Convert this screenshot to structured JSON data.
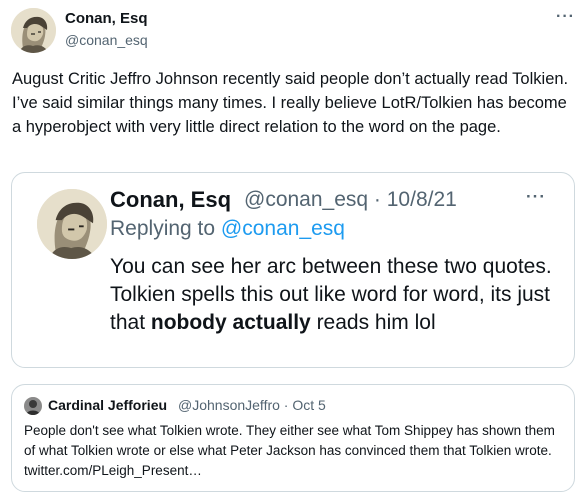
{
  "tweet": {
    "author_name": "Conan, Esq",
    "author_handle": "@conan_esq",
    "more_icon": "···",
    "text": "August Critic Jeffro Johnson recently said people don’t actually read Tolkien. I’ve said similar things many times. I really believe LotR/Tolkien has become a hyperobject with very little direct relation to the word on the page."
  },
  "quoted_tweet": {
    "author_name": "Conan, Esq",
    "author_handle": "@conan_esq",
    "date": "10/8/21",
    "more_icon": "···",
    "replying_to_prefix": "Replying to",
    "replying_to_handle": "@conan_esq",
    "text_before_bold": "You can see her arc between these two quotes. Tolkien spells this out like word for word, its just that ",
    "text_bold": "nobody actually",
    "text_after_bold": " reads him lol"
  },
  "nested_quote": {
    "author_name": "Cardinal Jefforieu",
    "author_handle": "@JohnsonJeffro",
    "date": "Oct 5",
    "text": "People don't see what Tolkien wrote. They either see what Tom Shippey has shown them of what Tolkien wrote or else what Peter Jackson has convinced them that Tolkien wrote. twitter.com/PLeigh_Present…"
  }
}
